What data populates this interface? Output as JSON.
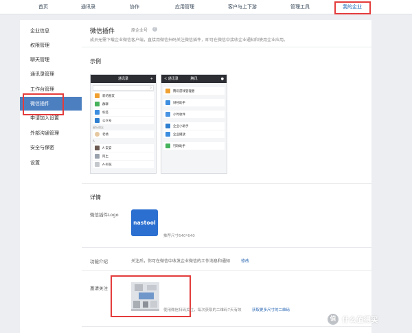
{
  "topnav": {
    "items": [
      "首页",
      "通讯录",
      "协作",
      "应用管理",
      "客户与上下游",
      "管理工具",
      "我的企业"
    ],
    "active": "我的企业"
  },
  "sidebar": {
    "items": [
      "企业信息",
      "权限管理",
      "聊天管理",
      "通讯录管理",
      "工作台管理",
      "微信插件",
      "申请加入设置",
      "外部沟通管理",
      "安全与保密",
      "设置"
    ],
    "active": "微信插件"
  },
  "main": {
    "title": "微信插件",
    "title_sub": "原企业号",
    "description": "成员无需下载企业微信客户端，直接用微信扫码关注微信插件，即可在微信中接收企业通知和使用企业应用。",
    "example_label": "示例",
    "phone_left": {
      "title": "通讯录",
      "rows": [
        {
          "text": "新的朋友",
          "color": "#f0a030"
        },
        {
          "text": "群聊",
          "color": "#46b35c"
        },
        {
          "text": "标签",
          "color": "#3e8ee0"
        },
        {
          "text": "公众号",
          "color": "#2f7fd0"
        }
      ],
      "group_a": "星标朋友",
      "contact_a": "老杨",
      "group_b": "A",
      "contact_b": "A 安安",
      "contact_c": "阿土",
      "contact_d": "A-阿花"
    },
    "phone_right": {
      "back": "< 通讯录",
      "title": "腾讯",
      "rows": [
        {
          "text": "腾讯游戏管理者",
          "color": "#f0a030"
        },
        {
          "text": "财经助手",
          "color": "#3e8ee0"
        },
        {
          "text": "小时收件",
          "color": "#4a95e3"
        },
        {
          "text": "企业小助手",
          "color": "#2f7fd0"
        },
        {
          "text": "企业播放",
          "color": "#3e8ee0"
        },
        {
          "text": "行政助手",
          "color": "#46b35c"
        }
      ]
    },
    "details_label": "详情",
    "logo_label": "微信插件Logo",
    "logo_text": "nastool",
    "logo_hint": "推荐尺寸640*640",
    "intro_label": "功能介绍",
    "intro_text": "关注后，你可在微信中收发企业微信的工作消息和通知",
    "edit_link": "修改",
    "invite_label": "邀请关注",
    "qr_hint": "使用微信扫码关注，每次获取的二维码7天有效",
    "more_link": "获取更多尺寸的二维码",
    "bottom_dashes": "- - - -"
  },
  "watermark": {
    "glyph": "值",
    "text": "什么值得买"
  },
  "colors": {
    "accent": "#4c7fc0",
    "highlight_box": "#e43b3b",
    "link": "#2a67b3",
    "logo_bg": "#2b6fd0"
  }
}
